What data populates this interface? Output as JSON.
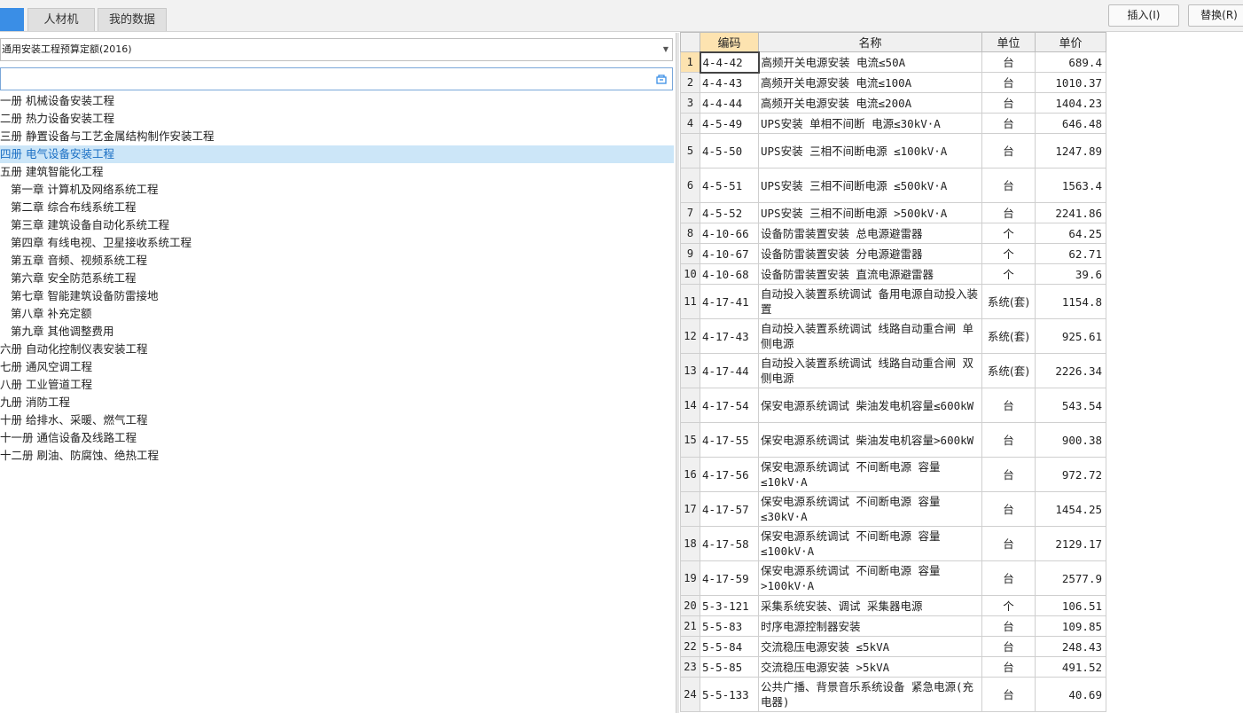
{
  "tabs": [
    {
      "label": "",
      "active": true
    },
    {
      "label": "人材机",
      "active": false
    },
    {
      "label": "我的数据",
      "active": false
    }
  ],
  "toolbar": {
    "insert_label": "插入(I)",
    "replace_label": "替换(R)"
  },
  "quota_select": {
    "value": "通用安装工程预算定额(2016)"
  },
  "search": {
    "value": ""
  },
  "tree": [
    {
      "label": "一册 机械设备安装工程",
      "indent": 0,
      "selected": false
    },
    {
      "label": "二册 热力设备安装工程",
      "indent": 0,
      "selected": false
    },
    {
      "label": "三册 静置设备与工艺金属结构制作安装工程",
      "indent": 0,
      "selected": false
    },
    {
      "label": "四册 电气设备安装工程",
      "indent": 0,
      "selected": true
    },
    {
      "label": "五册 建筑智能化工程",
      "indent": 0,
      "selected": false
    },
    {
      "label": "第一章 计算机及网络系统工程",
      "indent": 1,
      "selected": false
    },
    {
      "label": "第二章 综合布线系统工程",
      "indent": 1,
      "selected": false
    },
    {
      "label": "第三章 建筑设备自动化系统工程",
      "indent": 1,
      "selected": false
    },
    {
      "label": "第四章 有线电视、卫星接收系统工程",
      "indent": 1,
      "selected": false
    },
    {
      "label": "第五章 音频、视频系统工程",
      "indent": 1,
      "selected": false
    },
    {
      "label": "第六章 安全防范系统工程",
      "indent": 1,
      "selected": false
    },
    {
      "label": "第七章 智能建筑设备防雷接地",
      "indent": 1,
      "selected": false
    },
    {
      "label": "第八章 补充定额",
      "indent": 1,
      "selected": false
    },
    {
      "label": "第九章 其他调整费用",
      "indent": 1,
      "selected": false
    },
    {
      "label": "六册 自动化控制仪表安装工程",
      "indent": 0,
      "selected": false
    },
    {
      "label": "七册 通风空调工程",
      "indent": 0,
      "selected": false
    },
    {
      "label": "八册 工业管道工程",
      "indent": 0,
      "selected": false
    },
    {
      "label": "九册 消防工程",
      "indent": 0,
      "selected": false
    },
    {
      "label": "十册 给排水、采暖、燃气工程",
      "indent": 0,
      "selected": false
    },
    {
      "label": "十一册 通信设备及线路工程",
      "indent": 0,
      "selected": false
    },
    {
      "label": "十二册 刷油、防腐蚀、绝热工程",
      "indent": 0,
      "selected": false
    }
  ],
  "table": {
    "headers": {
      "index": "",
      "code": "编码",
      "name": "名称",
      "unit": "单位",
      "price": "单价"
    },
    "rows": [
      {
        "n": "1",
        "code": "4-4-42",
        "name": "高频开关电源安装 电流≤50A",
        "unit": "台",
        "price": "689.4",
        "h": 23
      },
      {
        "n": "2",
        "code": "4-4-43",
        "name": "高频开关电源安装 电流≤100A",
        "unit": "台",
        "price": "1010.37",
        "h": 23
      },
      {
        "n": "3",
        "code": "4-4-44",
        "name": "高频开关电源安装 电流≤200A",
        "unit": "台",
        "price": "1404.23",
        "h": 23
      },
      {
        "n": "4",
        "code": "4-5-49",
        "name": "UPS安装 单相不间断 电源≤30kV·A",
        "unit": "台",
        "price": "646.48",
        "h": 23
      },
      {
        "n": "5",
        "code": "4-5-50",
        "name": "UPS安装 三相不间断电源 ≤100kV·A",
        "unit": "台",
        "price": "1247.89",
        "h": 39
      },
      {
        "n": "6",
        "code": "4-5-51",
        "name": "UPS安装 三相不间断电源 ≤500kV·A",
        "unit": "台",
        "price": "1563.4",
        "h": 39
      },
      {
        "n": "7",
        "code": "4-5-52",
        "name": "UPS安装 三相不间断电源 >500kV·A",
        "unit": "台",
        "price": "2241.86",
        "h": 23
      },
      {
        "n": "8",
        "code": "4-10-66",
        "name": "设备防雷装置安装 总电源避雷器",
        "unit": "个",
        "price": "64.25",
        "h": 23
      },
      {
        "n": "9",
        "code": "4-10-67",
        "name": "设备防雷装置安装 分电源避雷器",
        "unit": "个",
        "price": "62.71",
        "h": 23
      },
      {
        "n": "10",
        "code": "4-10-68",
        "name": "设备防雷装置安装 直流电源避雷器",
        "unit": "个",
        "price": "39.6",
        "h": 23
      },
      {
        "n": "11",
        "code": "4-17-41",
        "name": "自动投入装置系统调试 备用电源自动投入装置",
        "unit": "系统(套)",
        "price": "1154.8",
        "h": 39
      },
      {
        "n": "12",
        "code": "4-17-43",
        "name": "自动投入装置系统调试 线路自动重合闸 单侧电源",
        "unit": "系统(套)",
        "price": "925.61",
        "h": 39
      },
      {
        "n": "13",
        "code": "4-17-44",
        "name": "自动投入装置系统调试 线路自动重合闸 双侧电源",
        "unit": "系统(套)",
        "price": "2226.34",
        "h": 39
      },
      {
        "n": "14",
        "code": "4-17-54",
        "name": "保安电源系统调试 柴油发电机容量≤600kW",
        "unit": "台",
        "price": "543.54",
        "h": 39
      },
      {
        "n": "15",
        "code": "4-17-55",
        "name": "保安电源系统调试 柴油发电机容量>600kW",
        "unit": "台",
        "price": "900.38",
        "h": 39
      },
      {
        "n": "16",
        "code": "4-17-56",
        "name": "保安电源系统调试 不间断电源 容量≤10kV·A",
        "unit": "台",
        "price": "972.72",
        "h": 39
      },
      {
        "n": "17",
        "code": "4-17-57",
        "name": "保安电源系统调试 不间断电源 容量≤30kV·A",
        "unit": "台",
        "price": "1454.25",
        "h": 39
      },
      {
        "n": "18",
        "code": "4-17-58",
        "name": "保安电源系统调试 不间断电源 容量≤100kV·A",
        "unit": "台",
        "price": "2129.17",
        "h": 39
      },
      {
        "n": "19",
        "code": "4-17-59",
        "name": "保安电源系统调试 不间断电源 容量>100kV·A",
        "unit": "台",
        "price": "2577.9",
        "h": 39
      },
      {
        "n": "20",
        "code": "5-3-121",
        "name": "采集系统安装、调试 采集器电源",
        "unit": "个",
        "price": "106.51",
        "h": 23
      },
      {
        "n": "21",
        "code": "5-5-83",
        "name": "时序电源控制器安装",
        "unit": "台",
        "price": "109.85",
        "h": 23
      },
      {
        "n": "22",
        "code": "5-5-84",
        "name": "交流稳压电源安装 ≤5kVA",
        "unit": "台",
        "price": "248.43",
        "h": 23
      },
      {
        "n": "23",
        "code": "5-5-85",
        "name": "交流稳压电源安装 >5kVA",
        "unit": "台",
        "price": "491.52",
        "h": 23
      },
      {
        "n": "24",
        "code": "5-5-133",
        "name": "公共广播、背景音乐系统设备 紧急电源(充电器)",
        "unit": "台",
        "price": "40.69",
        "h": 39
      }
    ]
  }
}
